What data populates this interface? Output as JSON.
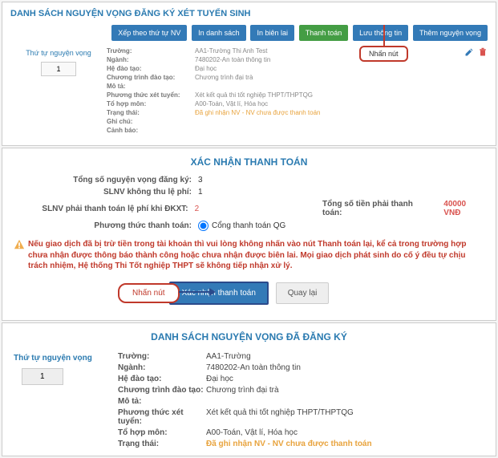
{
  "panel1": {
    "title": "DANH SÁCH NGUYỆN VỌNG ĐĂNG KÝ XÉT TUYỂN SINH",
    "buttons": {
      "sort": "Xếp theo thứ tự NV",
      "print_list": "In danh sách",
      "print_receipt": "In biên lai",
      "pay": "Thanh toán",
      "save": "Lưu thông tin",
      "add": "Thêm nguyện vọng"
    },
    "callout": "Nhấn nút",
    "order_label": "Thứ tự nguyện vọng",
    "order_value": "1",
    "rows": {
      "truong_lbl": "Trường:",
      "truong_val": "AA1-Trường Thi Anh Test",
      "nganh_lbl": "Ngành:",
      "nganh_val": "7480202-An toàn thông tin",
      "hedt_lbl": "Hệ đào tạo:",
      "hedt_val": "Đại học",
      "ctdt_lbl": "Chương trình đào tạo:",
      "ctdt_val": "Chương trình đại trà",
      "mota_lbl": "Mô tả:",
      "ptxt_lbl": "Phương thức xét tuyển:",
      "ptxt_val": "Xét kết quả thi tốt nghiệp THPT/THPTQG",
      "thm_lbl": "Tổ hợp môn:",
      "thm_val": "A00-Toán, Vật lí, Hóa học",
      "tt_lbl": "Trạng thái:",
      "tt_val": "Đã ghi nhận NV - NV chưa được thanh toán",
      "gc_lbl": "Ghi chú:",
      "cb_lbl": "Cảnh báo:"
    }
  },
  "panel2": {
    "title": "XÁC NHẬN THANH TOÁN",
    "rows": {
      "total_lbl": "Tổng số nguyện vọng đăng ký:",
      "total_val": "3",
      "nofee_lbl": "SLNV không thu lệ phí:",
      "nofee_val": "1",
      "fee_lbl": "SLNV phải thanh toán lệ phí khi ĐKXT:",
      "fee_val": "2",
      "amount_lbl": "Tổng số tiền phải thanh toán:",
      "amount_val": "40000 VNĐ",
      "method_lbl": "Phương thức thanh toán:",
      "method_opt": "Cổng thanh toán QG"
    },
    "warning": "Nếu giao dịch đã bị trừ tiền trong tài khoản thì vui lòng không nhấn vào nút Thanh toán lại, kể cả trong trường hợp chưa nhận được thông báo thành công hoặc chưa nhận được biên lai. Mọi giao dịch phát sinh do cố ý đều tự chịu trách nhiệm, Hệ thống Thi Tốt nghiệp THPT sẽ không tiếp nhận xử lý.",
    "callout": "Nhấn nút",
    "btn_confirm": "Xác nhận thanh toán",
    "btn_back": "Quay lại"
  },
  "panel3": {
    "title": "DANH SÁCH NGUYỆN VỌNG ĐÃ ĐĂNG KÝ",
    "order_label": "Thứ tự nguyện vọng",
    "order_value": "1",
    "rows": {
      "truong_lbl": "Trường:",
      "truong_val": "AA1-Trường",
      "nganh_lbl": "Ngành:",
      "nganh_val": "7480202-An toàn thông tin",
      "hedt_lbl": "Hệ đào tạo:",
      "hedt_val": "Đại học",
      "ctdt_lbl": "Chương trình đào tạo:",
      "ctdt_val": "Chương trình đại trà",
      "mota_lbl": "Mô tả:",
      "ptxt_lbl": "Phương thức xét tuyển:",
      "ptxt_val": "Xét kết quả thi tốt nghiệp THPT/THPTQG",
      "thm_lbl": "Tổ hợp môn:",
      "thm_val": "A00-Toán, Vật lí, Hóa học",
      "tt_lbl": "Trạng thái:",
      "tt_val": "Đã ghi nhận NV - NV chưa được thanh toán"
    }
  }
}
